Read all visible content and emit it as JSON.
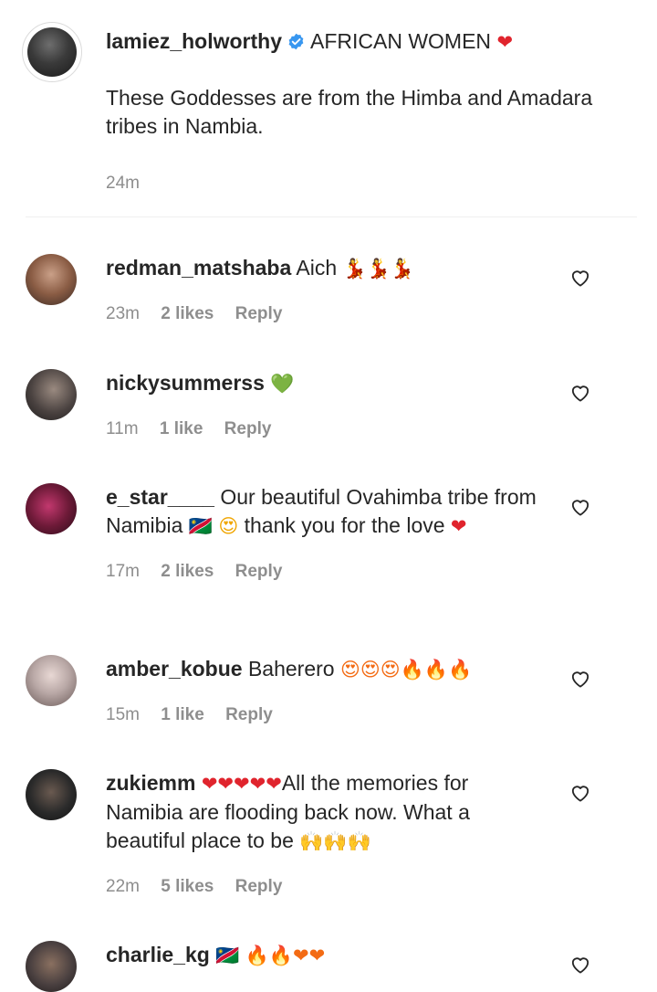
{
  "caption": {
    "username": "lamiez_holworthy",
    "headline": "AFRICAN WOMEN",
    "headline_emoji": "❤",
    "text": "These Goddesses are from the Himba and Amadara tribes in Nambia.",
    "time": "24m"
  },
  "comments": [
    {
      "username": "redman_matshaba",
      "text": "Aich",
      "emoji": "💃💃💃",
      "time": "23m",
      "likes": "2 likes",
      "reply": "Reply",
      "avatar_color": "#6b4a3a"
    },
    {
      "username": "nickysummerss",
      "text": "",
      "emoji": "💚",
      "time": "11m",
      "likes": "1 like",
      "reply": "Reply",
      "avatar_color": "#3b3b3b"
    },
    {
      "username": "e_star____",
      "text": "Our beautiful Ovahimba tribe from Namibia",
      "flag": "🇳🇦",
      "emoji_mid": "😍",
      "text2": "thank you for the love",
      "emoji": "❤",
      "time": "17m",
      "likes": "2 likes",
      "reply": "Reply",
      "avatar_color": "#7a1f3d"
    },
    {
      "username": "amber_kobue",
      "text": "Baherero",
      "emoji": "😍😍😍🔥🔥🔥",
      "time": "15m",
      "likes": "1 like",
      "reply": "Reply",
      "avatar_color": "#b9a8a6"
    },
    {
      "username": "zukiemm",
      "emoji_lead": "❤❤❤❤❤",
      "text": "All the memories for Namibia are flooding back now. What a beautiful place to be",
      "emoji": "🙌🙌🙌",
      "time": "22m",
      "likes": "5 likes",
      "reply": "Reply",
      "avatar_color": "#2a2a2a"
    },
    {
      "username": "charlie_kg",
      "flag": "🇳🇦",
      "emoji": "🔥🔥❤❤",
      "avatar_color": "#4a4040"
    }
  ],
  "colors": {
    "verified_blue": "#3897f0",
    "heart_red": "#e0242d",
    "meta_gray": "#8e8e8e"
  },
  "icons": {
    "verified": "verified-badge-icon",
    "like": "heart-outline-icon"
  }
}
